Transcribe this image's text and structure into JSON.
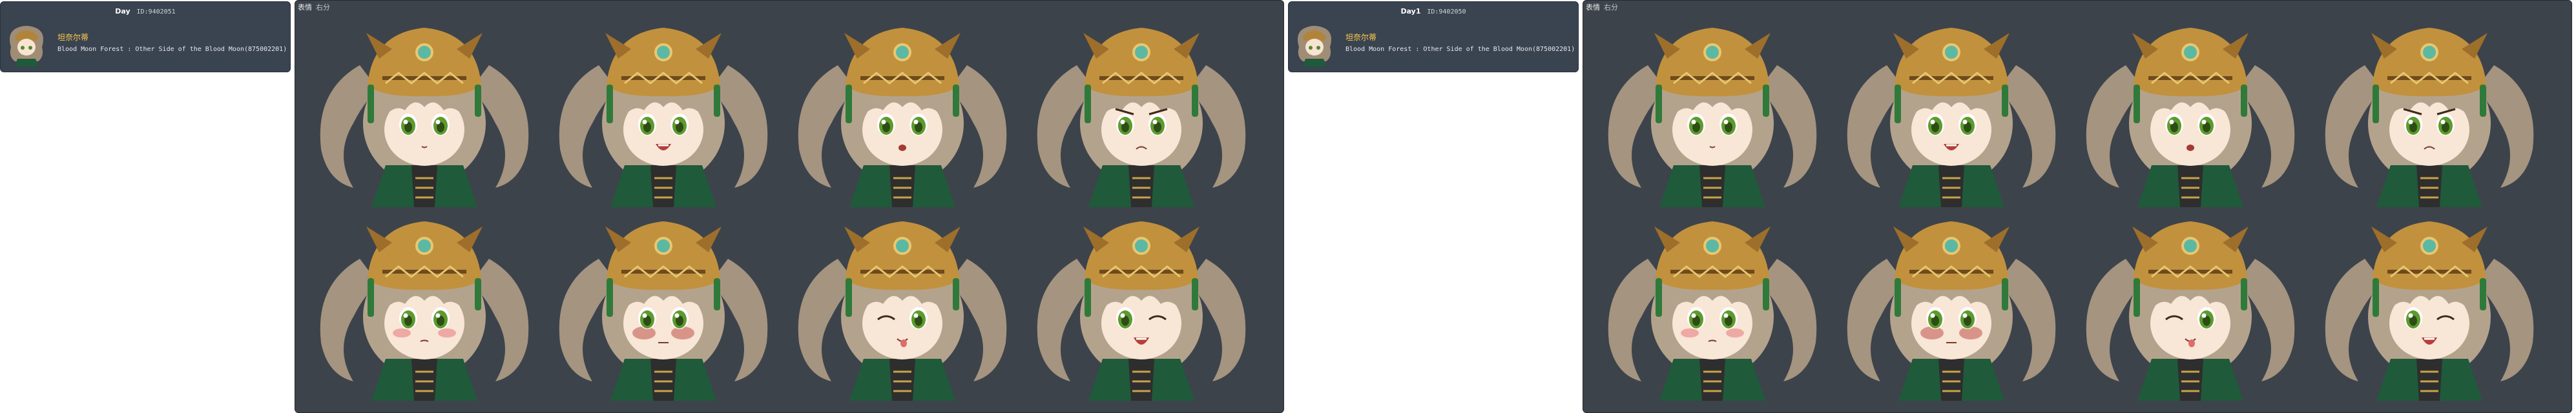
{
  "colors": {
    "panel_bg": "#3d434b",
    "card_bg": "#3a4350",
    "name_color": "#ffd04a"
  },
  "cards": [
    {
      "title": "Day",
      "id": "ID:9402051",
      "npc_name": "坦奈尔蒂",
      "location": "Blood Moon Forest : Other Side of the Blood Moon(875002201)"
    },
    {
      "title": "Day1",
      "id": "ID:9402050",
      "npc_name": "坦奈尔蒂",
      "location": "Blood Moon Forest : Other Side of the Blood Moon(875002201)"
    }
  ],
  "panels": [
    {
      "label": "表情",
      "sub": "右分"
    },
    {
      "label": "表情",
      "sub": "右分"
    }
  ],
  "expressions": [
    "default",
    "smile",
    "surprised",
    "troubled",
    "blush",
    "angry",
    "tongue",
    "wink"
  ]
}
